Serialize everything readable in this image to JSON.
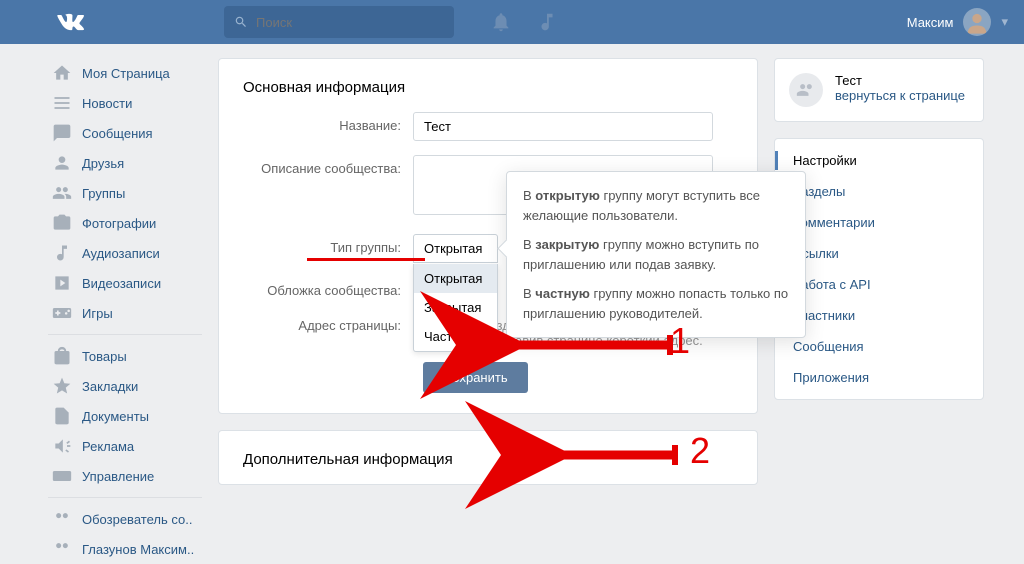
{
  "header": {
    "search_placeholder": "Поиск",
    "username": "Максим"
  },
  "sidebar": {
    "items": [
      {
        "label": "Моя Страница",
        "icon": "home"
      },
      {
        "label": "Новости",
        "icon": "feed"
      },
      {
        "label": "Сообщения",
        "icon": "msg"
      },
      {
        "label": "Друзья",
        "icon": "friends"
      },
      {
        "label": "Группы",
        "icon": "groups"
      },
      {
        "label": "Фотографии",
        "icon": "photo"
      },
      {
        "label": "Аудиозаписи",
        "icon": "audio"
      },
      {
        "label": "Видеозаписи",
        "icon": "video"
      },
      {
        "label": "Игры",
        "icon": "game"
      }
    ],
    "items2": [
      {
        "label": "Товары",
        "icon": "market"
      },
      {
        "label": "Закладки",
        "icon": "fav"
      },
      {
        "label": "Документы",
        "icon": "doc"
      },
      {
        "label": "Реклама",
        "icon": "ads"
      },
      {
        "label": "Управление",
        "icon": "manage"
      }
    ],
    "items3": [
      {
        "label": "Обозреватель со..",
        "icon": "groups"
      },
      {
        "label": "Глазунов Максим..",
        "icon": "groups"
      }
    ]
  },
  "panel": {
    "title": "Основная информация",
    "name_label": "Название:",
    "name_value": "Тест",
    "desc_label": "Описание сообщества:",
    "type_label": "Тип группы:",
    "cover_label": "Обложка сообщества:",
    "addr_label": "Адрес страницы:",
    "addr_hint": "Вы можете создать наклейки для Вашего сообщества, добавив странице короткий адрес.",
    "save_label": "Сохранить",
    "extra_title": "Дополнительная информация"
  },
  "dropdown": {
    "selected": "Открытая",
    "options": [
      "Открытая",
      "Закрытая",
      "Частная"
    ]
  },
  "tooltip": {
    "p1_pre": "В ",
    "p1_b": "открытую",
    "p1_post": " группу могут вступить все желающие пользователи.",
    "p2_pre": "В ",
    "p2_b": "закрытую",
    "p2_post": " группу можно вступить по приглашению или подав заявку.",
    "p3_pre": "В ",
    "p3_b": "частную",
    "p3_post": " группу можно попасть только по приглашению руководителей."
  },
  "group_box": {
    "name": "Тест",
    "back": "вернуться к странице"
  },
  "settings_nav": [
    {
      "label": "Настройки",
      "active": true
    },
    {
      "label": "Разделы"
    },
    {
      "label": "Комментарии"
    },
    {
      "label": "Ссылки"
    },
    {
      "label": "Работа с API"
    },
    {
      "label": "Участники"
    },
    {
      "label": "Сообщения"
    },
    {
      "label": "Приложения"
    }
  ],
  "annotations": {
    "num1": "1",
    "num2": "2"
  }
}
